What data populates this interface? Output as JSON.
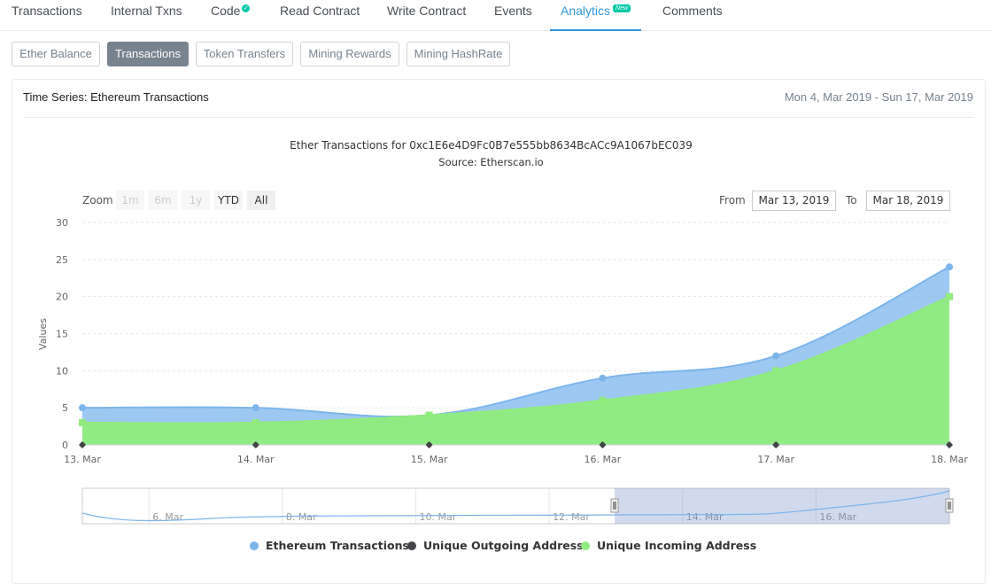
{
  "tabs": [
    {
      "label": "Transactions"
    },
    {
      "label": "Internal Txns"
    },
    {
      "label": "Code"
    },
    {
      "label": "Read Contract"
    },
    {
      "label": "Write Contract"
    },
    {
      "label": "Events"
    },
    {
      "label": "Analytics",
      "badge": "New"
    },
    {
      "label": "Comments"
    }
  ],
  "subtabs": [
    "Ether Balance",
    "Transactions",
    "Token Transfers",
    "Mining Rewards",
    "Mining HashRate"
  ],
  "card": {
    "title": "Time Series: Ethereum Transactions",
    "date_range": "Mon 4, Mar 2019 - Sun 17, Mar 2019"
  },
  "zoom": {
    "label": "Zoom",
    "buttons": [
      "1m",
      "6m",
      "1y",
      "YTD",
      "All"
    ],
    "from_label": "From",
    "from_value": "Mar 13, 2019",
    "to_label": "To",
    "to_value": "Mar 18, 2019"
  },
  "colors": {
    "accent": "#3498db",
    "ether_tx": "#7cb5ec",
    "outgoing": "#434348",
    "incoming": "#90ed7d"
  },
  "chart_data": {
    "type": "area",
    "title": "Ether Transactions for 0xc1E6e4D9Fc0B7e555bb8634BcACc9A1067bEC039",
    "subtitle": "Source: Etherscan.io",
    "ylabel": "Values",
    "xlabel": "",
    "ylim": [
      0,
      30
    ],
    "yticks": [
      "0",
      "5",
      "10",
      "15",
      "20",
      "25",
      "30"
    ],
    "categories": [
      "13. Mar",
      "14. Mar",
      "15. Mar",
      "16. Mar",
      "17. Mar",
      "18. Mar"
    ],
    "series": [
      {
        "name": "Ethereum Transactions",
        "values": [
          5,
          5,
          4,
          9,
          12,
          24
        ]
      },
      {
        "name": "Unique Outgoing Address",
        "values": [
          0,
          0,
          0,
          0,
          0,
          0
        ]
      },
      {
        "name": "Unique Incoming Address",
        "values": [
          3,
          3,
          4,
          6,
          10,
          20
        ]
      }
    ],
    "grid": true,
    "legend": "bottom-center",
    "navigator": {
      "labels": [
        "6. Mar",
        "8. Mar",
        "10. Mar",
        "12. Mar",
        "14. Mar",
        "16. Mar"
      ]
    }
  }
}
